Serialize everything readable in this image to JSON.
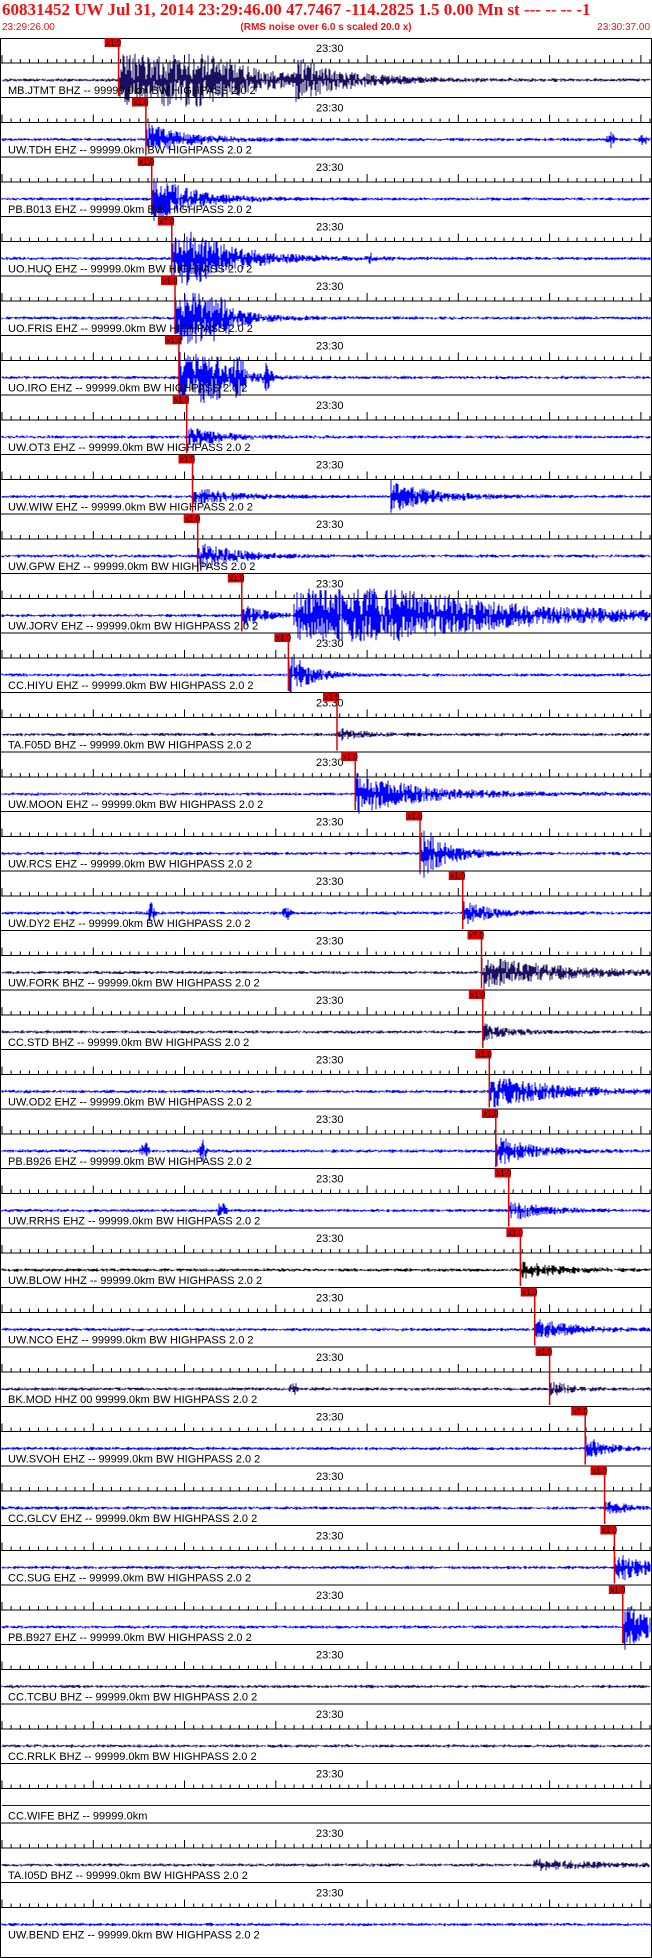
{
  "header": {
    "title": "60831452 UW Jul 31, 2014 23:29:46.00   47.7467 -114.2825  1.5 0.00 Mn st --- -- --  -1",
    "start_time": "23:29:26.00",
    "subtitle": "(RMS noise over 6.0 s scaled 20.0 x)",
    "end_time": "23:30:37.00"
  },
  "colors": {
    "header_text": "#ee1111",
    "pick": "#dd0000"
  },
  "chart_data": {
    "type": "line",
    "x_range": [
      "23:29:26.00",
      "23:30:37.00"
    ],
    "time_label": "23:30",
    "pick_label": "x1.0",
    "traces": [
      {
        "name": "MB.JTMT BHZ -- 99999.0km BW  HIGHPASS  2.0  2",
        "color": "#1a1060",
        "pick": 0.18,
        "profile": [
          [
            0.18,
            9,
            10
          ],
          [
            0.24,
            11,
            8
          ],
          [
            0.45,
            4,
            8
          ]
        ],
        "bursts": []
      },
      {
        "name": "UW.TDH EHZ -- 99999.0km BW  HIGHPASS  2.0  2",
        "color": "#0000ff",
        "pick": 0.222,
        "profile": [
          [
            0.222,
            4,
            6
          ]
        ],
        "bursts": [
          [
            0.94,
            1.5
          ],
          [
            0.99,
            1.2
          ]
        ]
      },
      {
        "name": "PB.B013 EHZ -- 99999.0km BW  HIGHPASS  2.0  2",
        "color": "#0000ff",
        "pick": 0.231,
        "profile": [
          [
            0.231,
            6,
            6
          ]
        ],
        "bursts": []
      },
      {
        "name": "UO.HUQ EHZ -- 99999.0km BW  HIGHPASS  2.0  2",
        "color": "#0000ff",
        "pick": 0.262,
        "profile": [
          [
            0.262,
            11,
            7
          ]
        ],
        "bursts": [
          [
            0.57,
            1.0
          ]
        ]
      },
      {
        "name": "UO.FRIS EHZ -- 99999.0km BW  HIGHPASS  2.0  2",
        "color": "#0000ff",
        "pick": 0.267,
        "profile": [
          [
            0.267,
            13,
            5
          ]
        ],
        "bursts": [
          [
            0.345,
            3
          ],
          [
            0.33,
            2
          ]
        ]
      },
      {
        "name": "UO.IRO EHZ -- 99999.0km BW  HIGHPASS  2.0  2",
        "color": "#0000ff",
        "pick": 0.273,
        "profile": [
          [
            0.273,
            16,
            4
          ]
        ],
        "bursts": [
          [
            0.33,
            4
          ],
          [
            0.36,
            3
          ],
          [
            0.37,
            3
          ],
          [
            0.41,
            3
          ]
        ]
      },
      {
        "name": "UW.OT3 EHZ -- 99999.0km BW  HIGHPASS  2.0  2",
        "color": "#0000ff",
        "pick": 0.285,
        "profile": [
          [
            0.285,
            2.5,
            5
          ]
        ],
        "bursts": []
      },
      {
        "name": "UW.WIW EHZ -- 99999.0km BW  HIGHPASS  2.0  2",
        "color": "#0000ff",
        "pick": 0.294,
        "profile": [
          [
            0.294,
            2.2,
            6
          ],
          [
            0.6,
            4,
            6
          ]
        ],
        "bursts": []
      },
      {
        "name": "UW.GPW EHZ -- 99999.0km BW  HIGHPASS  2.0  2",
        "color": "#0000ff",
        "pick": 0.302,
        "profile": [
          [
            0.302,
            4,
            5
          ]
        ],
        "bursts": []
      },
      {
        "name": "UW.JORV EHZ -- 99999.0km BW  HIGHPASS  2.0  2",
        "color": "#0000ff",
        "pick": 0.37,
        "profile": [
          [
            0.37,
            3,
            3
          ],
          [
            0.45,
            13,
            22
          ]
        ],
        "bursts": []
      },
      {
        "name": "CC.HIYU EHZ -- 99999.0km BW  HIGHPASS  2.0  2",
        "color": "#0000ff",
        "pick": 0.442,
        "profile": [
          [
            0.442,
            6,
            3
          ]
        ],
        "bursts": []
      },
      {
        "name": "TA.F05D BHZ -- 99999.0km BW  HIGHPASS  2.0  2",
        "color": "#1a1060",
        "pick": 0.517,
        "profile": [
          [
            0.517,
            1.5,
            4
          ]
        ],
        "bursts": []
      },
      {
        "name": "UW.MOON EHZ -- 99999.0km BW  HIGHPASS  2.0  2",
        "color": "#0000ff",
        "pick": 0.545,
        "profile": [
          [
            0.545,
            5,
            10
          ]
        ],
        "bursts": []
      },
      {
        "name": "UW.RCS EHZ -- 99999.0km BW  HIGHPASS  2.0  2",
        "color": "#0000ff",
        "pick": 0.645,
        "profile": [
          [
            0.645,
            7,
            4
          ]
        ],
        "bursts": []
      },
      {
        "name": "UW.DY2 EHZ -- 99999.0km BW  HIGHPASS  2.0  2",
        "color": "#0000ff",
        "pick": 0.711,
        "profile": [
          [
            0.711,
            3,
            4
          ]
        ],
        "bursts": [
          [
            0.23,
            2
          ],
          [
            0.44,
            1.5
          ]
        ]
      },
      {
        "name": "UW.FORK BHZ -- 99999.0km BW  HIGHPASS  2.0  2",
        "color": "#1a1060",
        "pick": 0.74,
        "profile": [
          [
            0.74,
            4,
            12
          ]
        ],
        "bursts": []
      },
      {
        "name": "CC.STD BHZ -- 99999.0km BW  HIGHPASS  2.0  2",
        "color": "#1a1060",
        "pick": 0.742,
        "profile": [
          [
            0.742,
            2,
            4
          ]
        ],
        "bursts": []
      },
      {
        "name": "UW.OD2 EHZ -- 99999.0km BW  HIGHPASS  2.0  2",
        "color": "#0000ff",
        "pick": 0.752,
        "profile": [
          [
            0.752,
            4,
            10
          ]
        ],
        "bursts": []
      },
      {
        "name": "PB.B926 EHZ -- 99999.0km BW  HIGHPASS  2.0  2",
        "color": "#0000ff",
        "pick": 0.762,
        "profile": [
          [
            0.762,
            4,
            5
          ]
        ],
        "bursts": [
          [
            0.22,
            2
          ],
          [
            0.31,
            2
          ]
        ]
      },
      {
        "name": "UW.RRHS EHZ -- 99999.0km BW  HIGHPASS  2.0  2",
        "color": "#0000ff",
        "pick": 0.782,
        "profile": [
          [
            0.782,
            2.5,
            5
          ]
        ],
        "bursts": [
          [
            0.34,
            2.5
          ]
        ]
      },
      {
        "name": "UW.BLOW HHZ -- 99999.0km BW  HIGHPASS  2.0  2",
        "color": "#000000",
        "pick": 0.8,
        "profile": [
          [
            0.8,
            2,
            6
          ]
        ],
        "bursts": []
      },
      {
        "name": "UW.NCO EHZ -- 99999.0km BW  HIGHPASS  2.0  2",
        "color": "#0000ff",
        "pick": 0.822,
        "profile": [
          [
            0.822,
            2.5,
            6
          ]
        ],
        "bursts": []
      },
      {
        "name": "BK.MOD HHZ 00 99999.0km BW  HIGHPASS  2.0  2",
        "color": "#1a1060",
        "pick": 0.845,
        "profile": [
          [
            0.845,
            2,
            3
          ]
        ],
        "bursts": [
          [
            0.45,
            1.5
          ]
        ]
      },
      {
        "name": "UW.SVOH EHZ -- 99999.0km BW  HIGHPASS  2.0  2",
        "color": "#0000ff",
        "pick": 0.9,
        "profile": [
          [
            0.9,
            3,
            3
          ]
        ],
        "bursts": []
      },
      {
        "name": "CC.GLCV EHZ -- 99999.0km BW  HIGHPASS  2.0  2",
        "color": "#0000ff",
        "pick": 0.93,
        "profile": [
          [
            0.93,
            2,
            3
          ]
        ],
        "bursts": []
      },
      {
        "name": "CC.SUG EHZ -- 99999.0km BW  HIGHPASS  2.0  2",
        "color": "#0000ff",
        "pick": 0.945,
        "profile": [
          [
            0.945,
            4,
            5
          ]
        ],
        "bursts": []
      },
      {
        "name": "PB.B927 EHZ -- 99999.0km BW  HIGHPASS  2.0  2",
        "color": "#0000ff",
        "pick": 0.958,
        "profile": [
          [
            0.958,
            6,
            5
          ]
        ],
        "bursts": []
      },
      {
        "name": "CC.TCBU BHZ -- 99999.0km BW  HIGHPASS  2.0  2",
        "color": "#1a1060",
        "pick": null,
        "profile": [],
        "bursts": []
      },
      {
        "name": "CC.RRLK BHZ -- 99999.0km BW  HIGHPASS  2.0  2",
        "color": "#1a1060",
        "pick": null,
        "profile": [],
        "bursts": []
      },
      {
        "name": "CC.WIFE BHZ -- 99999.0km",
        "color": "#1a1060",
        "pick": null,
        "profile": [],
        "bursts": [],
        "flat": true
      },
      {
        "name": "TA.I05D BHZ -- 99999.0km BW  HIGHPASS  2.0  2",
        "color": "#1a1060",
        "pick": null,
        "profile": [
          [
            0.82,
            1.3,
            10
          ]
        ],
        "bursts": []
      },
      {
        "name": "UW.BEND EHZ -- 99999.0km BW  HIGHPASS  2.0  2",
        "color": "#0000ff",
        "pick": null,
        "profile": [],
        "bursts": []
      }
    ]
  }
}
